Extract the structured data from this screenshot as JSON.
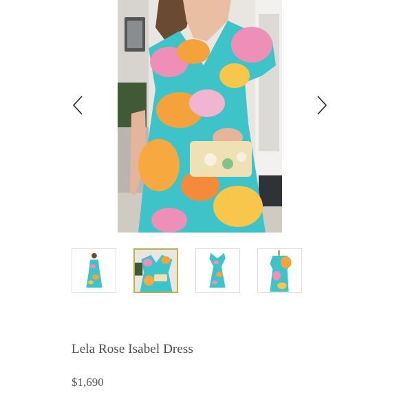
{
  "product": {
    "title": "Lela Rose Isabel Dress",
    "price": "$1,690"
  },
  "gallery": {
    "prev_icon": "chevron-left-icon",
    "next_icon": "chevron-right-icon",
    "main_image": "dress-photo-front-detail",
    "thumbnails": [
      {
        "icon": "dress-full-length-thumbnail",
        "selected": false
      },
      {
        "icon": "dress-detail-thumbnail",
        "selected": true
      },
      {
        "icon": "dress-flat-lay-thumbnail",
        "selected": false
      },
      {
        "icon": "dress-mannequin-side-thumbnail",
        "selected": false
      }
    ]
  },
  "colors": {
    "selected_border": "#b9b34a",
    "text": "#4b4b4b",
    "dress_turquoise": "#3ec4c8",
    "dress_orange": "#f4a23c",
    "dress_pink": "#ee8fb8"
  }
}
